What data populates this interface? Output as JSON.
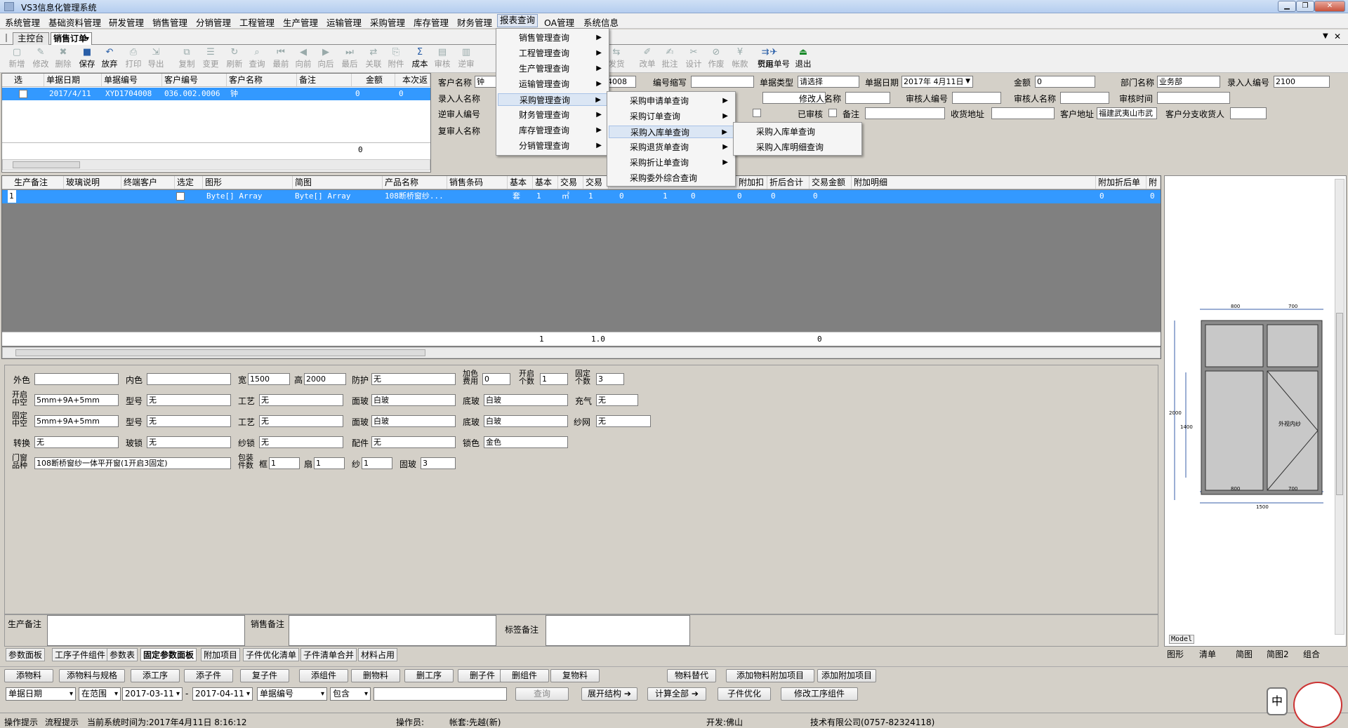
{
  "window": {
    "title": "VS3信息化管理系统"
  },
  "menubar": [
    "系统管理",
    "基础资料管理",
    "研发管理",
    "销售管理",
    "分销管理",
    "工程管理",
    "生产管理",
    "运输管理",
    "采购管理",
    "库存管理",
    "财务管理",
    "报表查询",
    "OA管理",
    "系统信息"
  ],
  "tabs": [
    "主控台",
    "销售订单"
  ],
  "toolbar": [
    "新增",
    "修改",
    "删除",
    "保存",
    "放弃",
    "打印",
    "导出",
    "复制",
    "变更",
    "刷新",
    "查询",
    "最前",
    "向前",
    "向后",
    "最后",
    "关联",
    "附件",
    "成本",
    "审核",
    "逆审",
    "",
    "",
    "",
    "",
    "发货",
    "改单",
    "批注",
    "设计",
    "作废",
    "帐款",
    "引用",
    "货运单号",
    "退出"
  ],
  "report_menu": [
    "销售管理查询",
    "工程管理查询",
    "生产管理查询",
    "运输管理查询",
    "采购管理查询",
    "财务管理查询",
    "库存管理查询",
    "分销管理查询"
  ],
  "purchase_menu": [
    "采购申请单查询",
    "采购订单查询",
    "采购入库单查询",
    "采购退货单查询",
    "采购折让单查询",
    "采购委外综合查询"
  ],
  "inbound_menu": [
    "采购入库单查询",
    "采购入库明细查询"
  ],
  "order_grid": {
    "headers": [
      "选",
      "单据日期",
      "单据编号",
      "客户编号",
      "客户名称",
      "备注",
      "金额",
      "本次返"
    ],
    "row": [
      "2017/4/11",
      "XYD1704008",
      "036.002.0006",
      "钟",
      "",
      "0",
      "0"
    ],
    "footer": "0"
  },
  "header_form": {
    "customer_name_label": "客户名称",
    "customer_name": "钟",
    "doc_no": "4008",
    "doc_abbr_label": "编号缩写",
    "doc_abbr": "",
    "doc_type_label": "单据类型",
    "doc_type": "请选择",
    "doc_date_label": "单据日期",
    "doc_date": "2017年 4月11日",
    "amount_label": "金额",
    "amount": "0",
    "dept_label": "部门名称",
    "dept": "业务部",
    "entry_no_label": "录入人编号",
    "entry_no": "2100",
    "entry_name_label": "录入人名称",
    "modify_name_label": "修改人名称",
    "auditor_no_label": "审核人编号",
    "auditor_name_label": "审核人名称",
    "audit_time_label": "审核时间",
    "reverse_no_label": "逆审人编号",
    "audited_label": "已审核",
    "remark_label": "备注",
    "receive_addr_label": "收货地址",
    "customer_addr_label": "客户地址",
    "customer_addr": "福建武夷山市武",
    "branch_receiver_label": "客户分支收货人",
    "review_name_label": "复审人名称"
  },
  "detail_grid": {
    "headers": [
      "生产备注",
      "玻璃说明",
      "终端客户",
      "选定",
      "图形",
      "简图",
      "产品名称",
      "销售条码",
      "基本",
      "基本",
      "交易",
      "交易",
      "",
      "",
      "",
      "附加扣",
      "折后合计",
      "交易金额",
      "附加明细",
      "附加折后单",
      "附加"
    ],
    "row": [
      "1",
      "Byte[] Array",
      "Byte[] Array",
      "108断桥窗纱...",
      "套",
      "1",
      "㎡",
      "1",
      "0",
      "1",
      "0",
      "0",
      "0",
      "0",
      "0",
      "0"
    ],
    "footer": [
      "1",
      "1.0",
      "0"
    ]
  },
  "params": {
    "outer_color": "外色",
    "inner_color": "内色",
    "width_label": "宽",
    "width": "1500",
    "height_label": "高",
    "height": "2000",
    "protect_label": "防护",
    "protect": "无",
    "color_fee_label": "加色费用",
    "color_fee": "0",
    "open_count_label": "开启个数",
    "open_count": "1",
    "fixed_count_label": "固定个数",
    "fixed_count": "3",
    "open_glass_label": "开启中空",
    "open_glass": "5mm+9A+5mm",
    "model_label": "型号",
    "model1": "无",
    "craft_label": "工艺",
    "craft1": "无",
    "face_label": "面玻",
    "face1": "白玻",
    "bottom_label": "底玻",
    "bottom1": "白玻",
    "gas_label": "充气",
    "gas": "无",
    "fixed_glass_label": "固定中空",
    "fixed_glass": "5mm+9A+5mm",
    "model2": "无",
    "craft2": "无",
    "face2": "白玻",
    "bottom2": "白玻",
    "screen_label": "纱网",
    "screen": "无",
    "convert_label": "转换",
    "convert": "无",
    "glass_lock_label": "玻锁",
    "glass_lock": "无",
    "screen_lock_label": "纱锁",
    "screen_lock": "无",
    "parts_label": "配件",
    "parts": "无",
    "lock_color_label": "锁色",
    "lock_color": "金色",
    "product_label": "门窗品种",
    "product": "108断桥窗纱一体平开窗(1开启3固定)",
    "pack_label": "包装件数",
    "frame_label": "框",
    "frame": "1",
    "sash_label": "扇",
    "sash": "1",
    "yarn_label": "纱",
    "yarn": "1",
    "fixglass_label": "固玻",
    "fixglass": "3"
  },
  "notes": {
    "prod": "生产备注",
    "sales": "销售备注",
    "tag": "标签备注"
  },
  "bottom_tabs": [
    "参数面板",
    "工序子件组件",
    "参数表",
    "固定参数面板",
    "附加项目",
    "子件优化清单",
    "子件清单合并",
    "材料占用"
  ],
  "right_tabs": [
    "图形",
    "清单",
    "简图",
    "简图2",
    "组合"
  ],
  "action_buttons": [
    "添物料",
    "添物料与规格",
    "添工序",
    "添子件",
    "复子件",
    "添组件",
    "删物料",
    "删工序",
    "删子件",
    "删组件",
    "复物料",
    "物料替代",
    "添加物料附加项目",
    "添加附加项目"
  ],
  "filter": {
    "field": "单据日期",
    "range": "在范围",
    "from": "2017-03-11",
    "to": "2017-04-11",
    "field2": "单据编号",
    "op": "包含",
    "query": "查询",
    "expand": "展开结构",
    "calc": "计算全部",
    "optimize": "子件优化",
    "modify": "修改工序组件"
  },
  "drawing": {
    "dim_top_left": "800",
    "dim_top_right": "700",
    "dim_bottom_left": "800",
    "dim_bottom_right": "700",
    "dim_total": "1500",
    "dim_h": "2000",
    "dim_h2": "1400",
    "sash_text": "外视内纱",
    "model": "Model"
  },
  "status": {
    "tip": "操作提示",
    "flow": "流程提示",
    "time": "当前系统时间为:2017年4月11日 8:16:12",
    "operator": "操作员:",
    "account": "帐套:先越(新)",
    "dev": "开发:佛山",
    "company": "技术有限公司(0757-82324118)"
  },
  "ime": "中"
}
